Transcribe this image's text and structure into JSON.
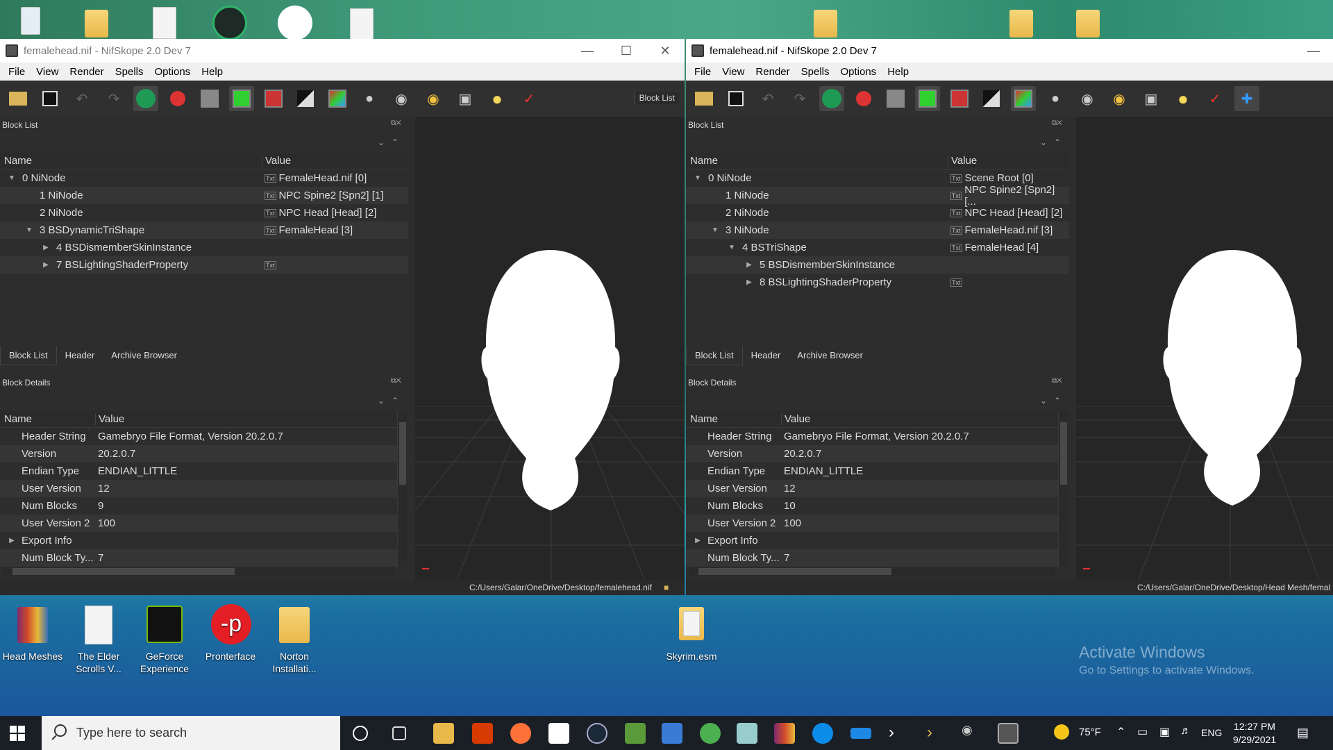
{
  "windows": [
    {
      "title": "femalehead.nif - NifSkope 2.0 Dev 7",
      "menu": [
        "File",
        "View",
        "Render",
        "Spells",
        "Options",
        "Help"
      ],
      "toolbar_block_list": "Block List",
      "block_list": {
        "title": "Block List",
        "columns": [
          "Name",
          "Value"
        ],
        "rows": [
          {
            "name": "0 NiNode",
            "value": "FemaleHead.nif [0]"
          },
          {
            "name": "1 NiNode",
            "value": "NPC Spine2 [Spn2] [1]"
          },
          {
            "name": "2 NiNode",
            "value": "NPC Head [Head] [2]"
          },
          {
            "name": "3 BSDynamicTriShape",
            "value": "FemaleHead [3]"
          },
          {
            "name": "4 BSDismemberSkinInstance",
            "value": ""
          },
          {
            "name": "7 BSLightingShaderProperty",
            "value": ""
          }
        ]
      },
      "tabs": [
        "Block List",
        "Header",
        "Archive Browser"
      ],
      "block_details": {
        "title": "Block Details",
        "columns": [
          "Name",
          "Value"
        ],
        "rows": [
          {
            "name": "Header String",
            "value": "Gamebryo File Format, Version 20.2.0.7"
          },
          {
            "name": "Version",
            "value": "20.2.0.7"
          },
          {
            "name": "Endian Type",
            "value": "ENDIAN_LITTLE"
          },
          {
            "name": "User Version",
            "value": "12"
          },
          {
            "name": "Num Blocks",
            "value": "9"
          },
          {
            "name": "User Version 2",
            "value": "100"
          },
          {
            "name": "Export Info",
            "value": ""
          },
          {
            "name": "Num Block Ty...",
            "value": "7"
          }
        ]
      },
      "status_path": "C:/Users/Galar/OneDrive/Desktop/femalehead.nif"
    },
    {
      "title": "femalehead.nif - NifSkope 2.0 Dev 7",
      "menu": [
        "File",
        "View",
        "Render",
        "Spells",
        "Options",
        "Help"
      ],
      "block_list": {
        "title": "Block List",
        "columns": [
          "Name",
          "Value"
        ],
        "rows": [
          {
            "name": "0 NiNode",
            "value": "Scene Root [0]"
          },
          {
            "name": "1 NiNode",
            "value": "NPC Spine2 [Spn2] [..."
          },
          {
            "name": "2 NiNode",
            "value": "NPC Head [Head] [2]"
          },
          {
            "name": "3 NiNode",
            "value": "FemaleHead.nif [3]"
          },
          {
            "name": "4 BSTriShape",
            "value": "FemaleHead [4]"
          },
          {
            "name": "5 BSDismemberSkinInstance",
            "value": ""
          },
          {
            "name": "8 BSLightingShaderProperty",
            "value": ""
          }
        ]
      },
      "tabs": [
        "Block List",
        "Header",
        "Archive Browser"
      ],
      "block_details": {
        "title": "Block Details",
        "columns": [
          "Name",
          "Value"
        ],
        "rows": [
          {
            "name": "Header String",
            "value": "Gamebryo File Format, Version 20.2.0.7"
          },
          {
            "name": "Version",
            "value": "20.2.0.7"
          },
          {
            "name": "Endian Type",
            "value": "ENDIAN_LITTLE"
          },
          {
            "name": "User Version",
            "value": "12"
          },
          {
            "name": "Num Blocks",
            "value": "10"
          },
          {
            "name": "User Version 2",
            "value": "100"
          },
          {
            "name": "Export Info",
            "value": ""
          },
          {
            "name": "Num Block Ty...",
            "value": "7"
          }
        ]
      },
      "status_path": "C:/Users/Galar/OneDrive/Desktop/Head Mesh/femal"
    }
  ],
  "desktop_icons": [
    {
      "label": "Head Meshes",
      "icon": "winrar-icon"
    },
    {
      "label": "The Elder Scrolls V...",
      "icon": "file-icon"
    },
    {
      "label": "GeForce Experience",
      "icon": "nvidia-icon"
    },
    {
      "label": "Pronterface",
      "icon": "pronterface-icon"
    },
    {
      "label": "Norton Installati...",
      "icon": "folder-icon"
    },
    {
      "label": "Skyrim.esm",
      "icon": "file-icon"
    }
  ],
  "activate": {
    "line1": "Activate Windows",
    "line2": "Go to Settings to activate Windows."
  },
  "taskbar": {
    "search_placeholder": "Type here to search",
    "weather": "75°F",
    "lang": "ENG",
    "time": "12:27 PM",
    "date": "9/29/2021"
  },
  "colors": {
    "accent_green": "#2fd02f",
    "desktop_teal": "#2a9d8f",
    "taskbar": "#1a1f26"
  }
}
